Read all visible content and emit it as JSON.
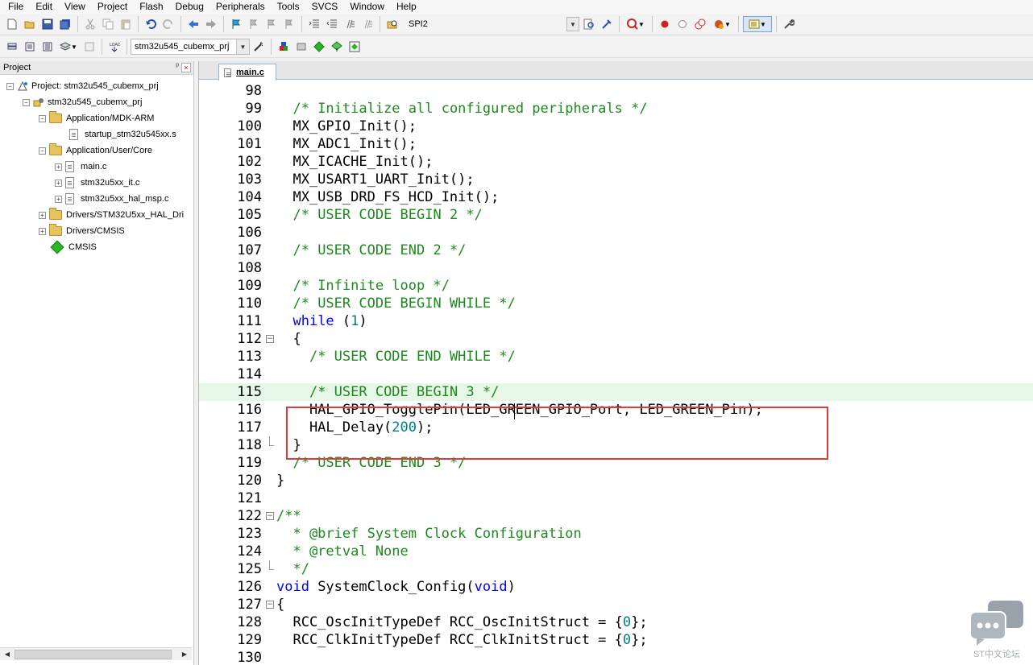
{
  "menu": [
    "File",
    "Edit",
    "View",
    "Project",
    "Flash",
    "Debug",
    "Peripherals",
    "Tools",
    "SVCS",
    "Window",
    "Help"
  ],
  "toolbar": {
    "find_combo_value": "SPI2",
    "target_combo_value": "stm32u545_cubemx_prj"
  },
  "project_panel": {
    "title": "Project",
    "pin_glyph": "ᵖ",
    "close_glyph": "×",
    "tree": {
      "project": "Project: stm32u545_cubemx_prj",
      "target": "stm32u545_cubemx_prj",
      "groups": [
        {
          "label": "Application/MDK-ARM",
          "files": [
            "startup_stm32u545xx.s"
          ]
        },
        {
          "label": "Application/User/Core",
          "files": [
            "main.c",
            "stm32u5xx_it.c",
            "stm32u5xx_hal_msp.c"
          ]
        },
        {
          "label": "Drivers/STM32U5xx_HAL_Dri"
        },
        {
          "label": "Drivers/CMSIS"
        }
      ],
      "component": "CMSIS"
    }
  },
  "editor": {
    "tab": "main.c",
    "lines": [
      {
        "n": "98",
        "t": ""
      },
      {
        "n": "99",
        "t": "  /* Initialize all configured peripherals */"
      },
      {
        "n": "100",
        "t": "  MX_GPIO_Init();"
      },
      {
        "n": "101",
        "t": "  MX_ADC1_Init();"
      },
      {
        "n": "102",
        "t": "  MX_ICACHE_Init();"
      },
      {
        "n": "103",
        "t": "  MX_USART1_UART_Init();"
      },
      {
        "n": "104",
        "t": "  MX_USB_DRD_FS_HCD_Init();"
      },
      {
        "n": "105",
        "t": "  /* USER CODE BEGIN 2 */"
      },
      {
        "n": "106",
        "t": ""
      },
      {
        "n": "107",
        "t": "  /* USER CODE END 2 */"
      },
      {
        "n": "108",
        "t": ""
      },
      {
        "n": "109",
        "t": "  /* Infinite loop */"
      },
      {
        "n": "110",
        "t": "  /* USER CODE BEGIN WHILE */"
      },
      {
        "n": "111",
        "t": "  while (1)"
      },
      {
        "n": "112",
        "t": "  {"
      },
      {
        "n": "113",
        "t": "    /* USER CODE END WHILE */"
      },
      {
        "n": "114",
        "t": ""
      },
      {
        "n": "115",
        "t": "    /* USER CODE BEGIN 3 */"
      },
      {
        "n": "116",
        "t": "    HAL_GPIO_TogglePin(LED_GREEN_GPIO_Port, LED_GREEN_Pin);"
      },
      {
        "n": "117",
        "t": "    HAL_Delay(200);"
      },
      {
        "n": "118",
        "t": "  }"
      },
      {
        "n": "119",
        "t": "  /* USER CODE END 3 */"
      },
      {
        "n": "120",
        "t": "}"
      },
      {
        "n": "121",
        "t": ""
      },
      {
        "n": "122",
        "t": "/**"
      },
      {
        "n": "123",
        "t": "  * @brief System Clock Configuration"
      },
      {
        "n": "124",
        "t": "  * @retval None"
      },
      {
        "n": "125",
        "t": "  */"
      },
      {
        "n": "126",
        "t": "void SystemClock_Config(void)"
      },
      {
        "n": "127",
        "t": "{"
      },
      {
        "n": "128",
        "t": "  RCC_OscInitTypeDef RCC_OscInitStruct = {0};"
      },
      {
        "n": "129",
        "t": "  RCC_ClkInitTypeDef RCC_ClkInitStruct = {0};"
      },
      {
        "n": "130",
        "t": ""
      }
    ]
  },
  "watermark": "ST中文论坛"
}
